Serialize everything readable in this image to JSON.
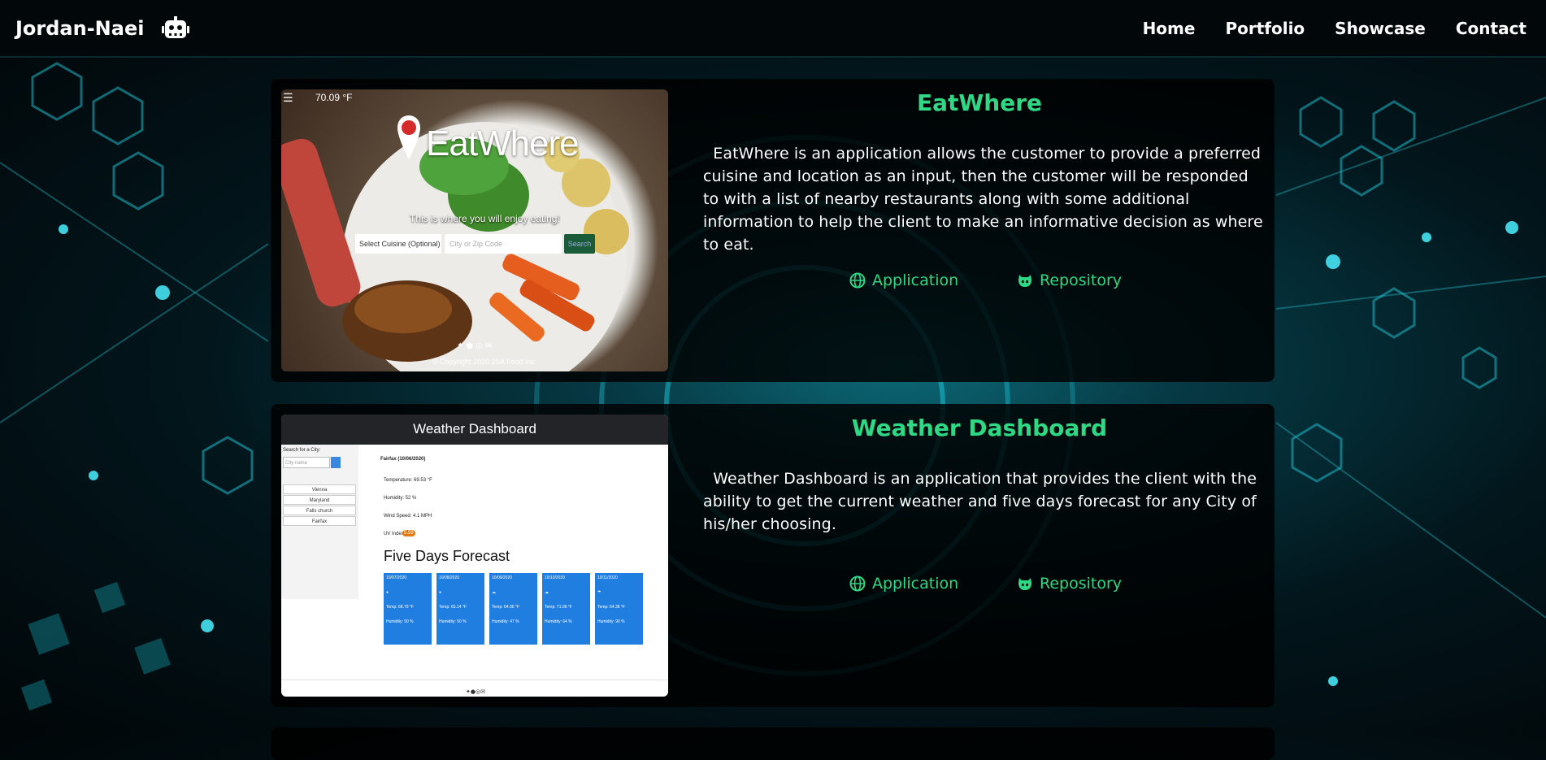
{
  "colors": {
    "accent": "#2fd884",
    "navbar_bg": "#02070a",
    "card_bg": "rgba(0,0,0,0.82)"
  },
  "navbar": {
    "brand": "Jordan-Naei",
    "brand_icon": "robot-icon",
    "links": [
      "Home",
      "Portfolio",
      "Showcase",
      "Contact"
    ]
  },
  "projects": [
    {
      "title": "EatWhere",
      "description": "EatWhere is an application allows the customer to provide a preferred cuisine and location as an input, then the customer will be responded to with a list of nearby restaurants along with some additional information to help the client to make an informative decision as where to eat.",
      "app_label": "Application",
      "app_icon": "globe-icon",
      "repo_label": "Repository",
      "repo_icon": "github-icon",
      "screenshot": {
        "temp": "70.09 °F",
        "logo": "EatWhere",
        "tagline": "This is where you will enjoy eating!",
        "cuisine_placeholder": "Select Cuisine (Optional)",
        "zip_placeholder": "City or Zip Code",
        "search": "Search",
        "copyright": "© Copyright 2020 JSA Food inc"
      }
    },
    {
      "title": "Weather Dashboard",
      "description": "Weather Dashboard is an application that provides the client with the ability to get the current weather and five days forecast for any City of his/her choosing.",
      "app_label": "Application",
      "app_icon": "globe-icon",
      "repo_label": "Repository",
      "repo_icon": "github-icon",
      "screenshot": {
        "header": "Weather Dashboard",
        "search_label": "Search for a City:",
        "search_placeholder": "City name",
        "cities": [
          "Vienna",
          "Maryland",
          "Falls church",
          "Fairfax"
        ],
        "current_city": "Fairfax (10/06/2020)",
        "temperature": "Temperature: 69.53 °F",
        "humidity": "Humidity: 52 %",
        "wind": "Wind Speed: 4.1 MPH",
        "uv": "UV Index:",
        "uv_value": "5.59",
        "forecast_title": "Five Days Forecast",
        "forecast": [
          {
            "date": "10/07/2020",
            "temp": "Temp: 68.79 °F",
            "hum": "Humidity: 50 %"
          },
          {
            "date": "10/08/2020",
            "temp": "Temp: 65.14 °F",
            "hum": "Humidity: 50 %"
          },
          {
            "date": "10/09/2020",
            "temp": "Temp: 64.06 °F",
            "hum": "Humidity: 47 %"
          },
          {
            "date": "10/10/2020",
            "temp": "Temp: 71.06 °F",
            "hum": "Humidity: 64 %"
          },
          {
            "date": "10/11/2020",
            "temp": "Temp: 64.38 °F",
            "hum": "Humidity: 90 %"
          }
        ]
      }
    }
  ]
}
